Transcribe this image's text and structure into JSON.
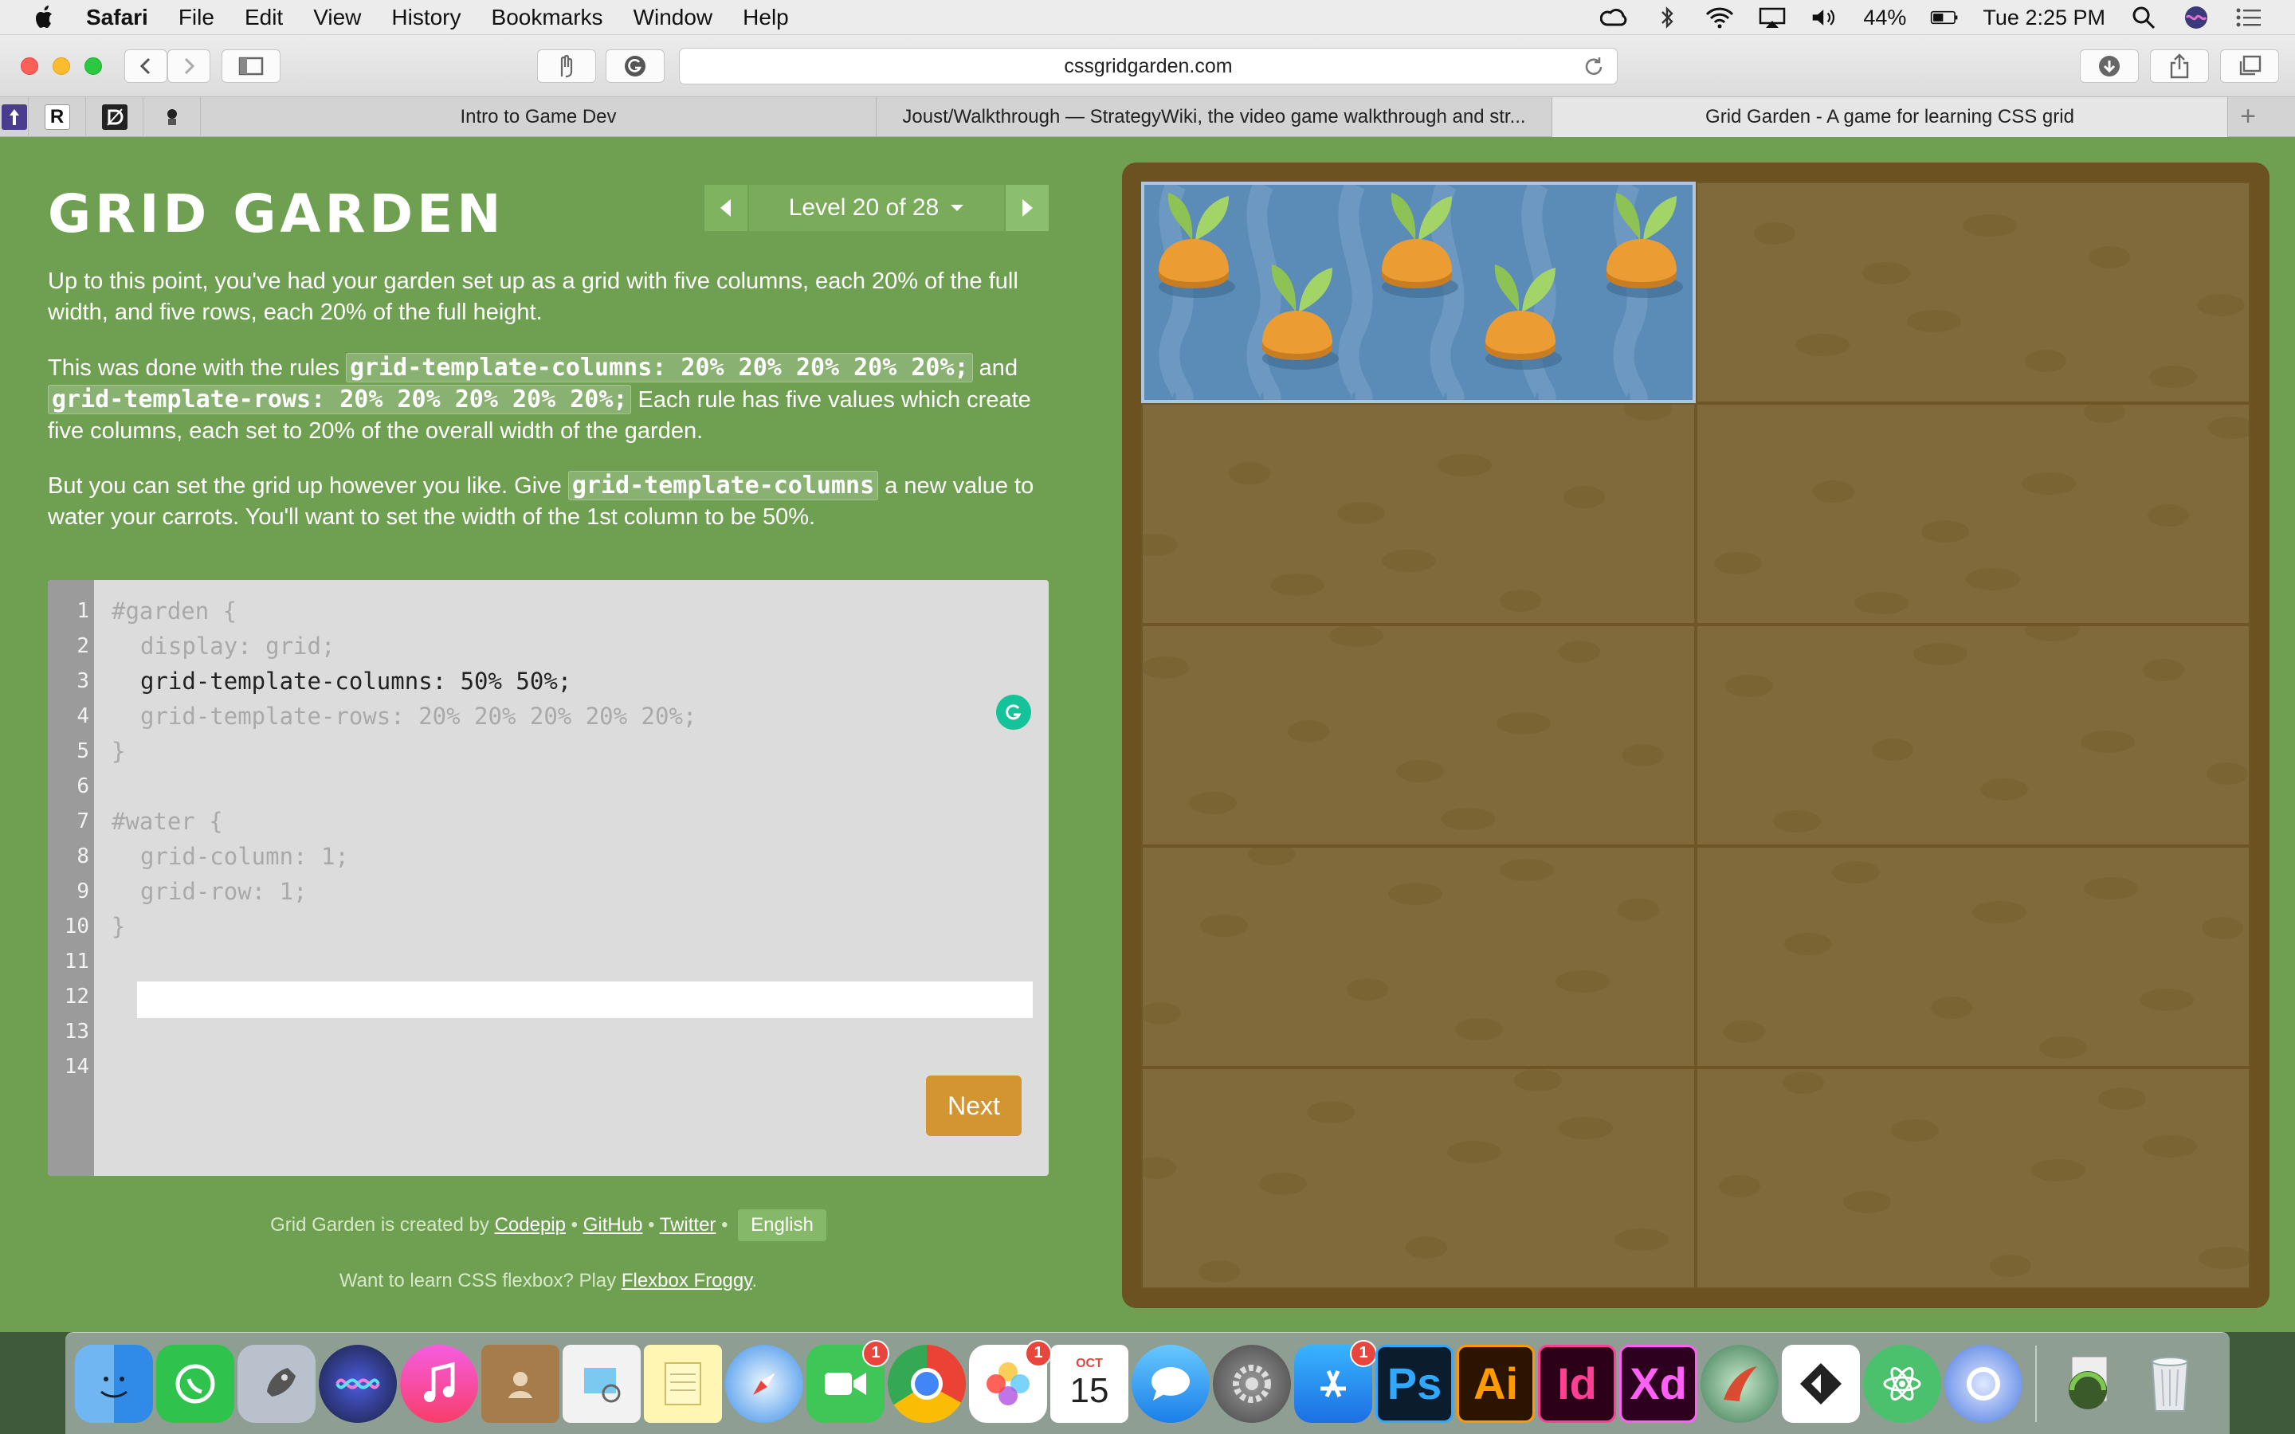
{
  "menubar": {
    "app": "Safari",
    "items": [
      "File",
      "Edit",
      "View",
      "History",
      "Bookmarks",
      "Window",
      "Help"
    ],
    "battery": "44%",
    "clock": "Tue 2:25 PM"
  },
  "toolbar": {
    "url": "cssgridgarden.com"
  },
  "tabs": [
    {
      "title": "Intro to Game Dev",
      "active": false
    },
    {
      "title": "Joust/Walkthrough — StrategyWiki, the video game walkthrough and str...",
      "active": false
    },
    {
      "title": "Grid Garden - A game for learning CSS grid",
      "active": true
    }
  ],
  "pinned_tabs": [
    "R"
  ],
  "game": {
    "title": "GRID GARDEN",
    "level_label": "Level 20 of 28",
    "instructions": {
      "p1": "Up to this point, you've had your garden set up as a grid with five columns, each 20% of the full width, and five rows, each 20% of the full height.",
      "p2_a": "This was done with the rules ",
      "p2_code1": "grid-template-columns: 20% 20% 20% 20% 20%;",
      "p2_b": " and ",
      "p2_code2": "grid-template-rows: 20% 20% 20% 20% 20%;",
      "p2_c": " Each rule has five values which create five columns, each set to 20% of the overall width of the garden.",
      "p3_a": "But you can set the grid up however you like. Give ",
      "p3_code": "grid-template-columns",
      "p3_b": " a new value to water your carrots. You'll want to set the width of the 1st column to be 50%."
    },
    "editor": {
      "line_numbers": [
        "1",
        "2",
        "3",
        "4",
        "5",
        "6",
        "7",
        "8",
        "9",
        "10",
        "11",
        "12",
        "13",
        "14"
      ],
      "lines": {
        "l1": "#garden {",
        "l2": "display: grid;",
        "l3": "grid-template-columns: 50% 50%;",
        "l4": "grid-template-rows: 20% 20% 20% 20% 20%;",
        "l5": "}",
        "l7": "#water {",
        "l8": "grid-column: 1;",
        "l9": "grid-row: 1;",
        "l10": "}"
      },
      "input_value": "",
      "next_label": "Next"
    },
    "credits": {
      "prefix": "Grid Garden is created by",
      "codepip": "Codepip",
      "github": "GitHub",
      "twitter": "Twitter",
      "language": "English",
      "sep": "•"
    },
    "froggy": {
      "prefix": "Want to learn CSS flexbox? Play",
      "link": "Flexbox Froggy",
      "suffix": "."
    }
  },
  "dock": {
    "badges": {
      "facetime": "1",
      "photos": "1",
      "appstore": "1"
    },
    "calendar": {
      "month": "OCT",
      "day": "15"
    },
    "labels": {
      "ps": "Ps",
      "ai": "Ai",
      "id": "Id",
      "xd": "Xd"
    }
  },
  "colors": {
    "page_bg": "#6fa052",
    "soil": "#80693b",
    "water": "#5b8bb7",
    "next_button": "#d39432"
  }
}
